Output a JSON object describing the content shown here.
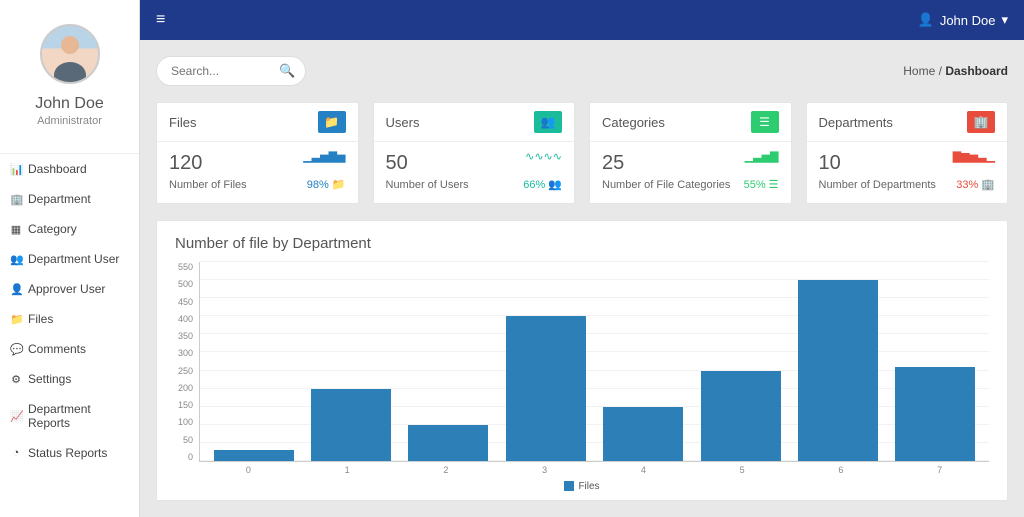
{
  "user": {
    "name": "John Doe",
    "role": "Administrator"
  },
  "topbar": {
    "user_label": "John Doe"
  },
  "search": {
    "placeholder": "Search..."
  },
  "breadcrumb": {
    "home": "Home",
    "sep": "/",
    "current": "Dashboard"
  },
  "sidebar": {
    "items": [
      {
        "icon": "dashboard-icon",
        "glyph": "📊",
        "label": "Dashboard"
      },
      {
        "icon": "building-icon",
        "glyph": "🏢",
        "label": "Department"
      },
      {
        "icon": "grid-icon",
        "glyph": "▦",
        "label": "Category"
      },
      {
        "icon": "users-icon",
        "glyph": "👥",
        "label": "Department User"
      },
      {
        "icon": "user-icon",
        "glyph": "👤",
        "label": "Approver User"
      },
      {
        "icon": "folder-icon",
        "glyph": "📁",
        "label": "Files"
      },
      {
        "icon": "comment-icon",
        "glyph": "💬",
        "label": "Comments"
      },
      {
        "icon": "gear-icon",
        "glyph": "⚙",
        "label": "Settings"
      },
      {
        "icon": "chart-icon",
        "glyph": "📈",
        "label": "Department Reports"
      },
      {
        "icon": "pie-icon",
        "glyph": "◔",
        "label": "Status Reports"
      }
    ]
  },
  "cards": [
    {
      "title": "Files",
      "value": "120",
      "sub": "Number of Files",
      "pct": "98%",
      "icon_glyph": "📁",
      "color": "blue"
    },
    {
      "title": "Users",
      "value": "50",
      "sub": "Number of Users",
      "pct": "66%",
      "icon_glyph": "👥",
      "color": "teal"
    },
    {
      "title": "Categories",
      "value": "25",
      "sub": "Number of File Categories",
      "pct": "55%",
      "icon_glyph": "☰",
      "color": "green"
    },
    {
      "title": "Departments",
      "value": "10",
      "sub": "Number of Departments",
      "pct": "33%",
      "icon_glyph": "🏢",
      "color": "red"
    }
  ],
  "panel": {
    "title": "Number of file by Department"
  },
  "chart_data": {
    "type": "bar",
    "title": "Number of file by Department",
    "categories": [
      "0",
      "1",
      "2",
      "3",
      "4",
      "5",
      "6",
      "7"
    ],
    "series": [
      {
        "name": "Files",
        "values": [
          30,
          200,
          100,
          400,
          150,
          250,
          500,
          260
        ]
      }
    ],
    "xlabel": "",
    "ylabel": "",
    "ylim": [
      0,
      550
    ],
    "yticks": [
      0,
      50,
      100,
      150,
      200,
      250,
      300,
      350,
      400,
      450,
      500,
      550
    ],
    "legend": "Files"
  }
}
